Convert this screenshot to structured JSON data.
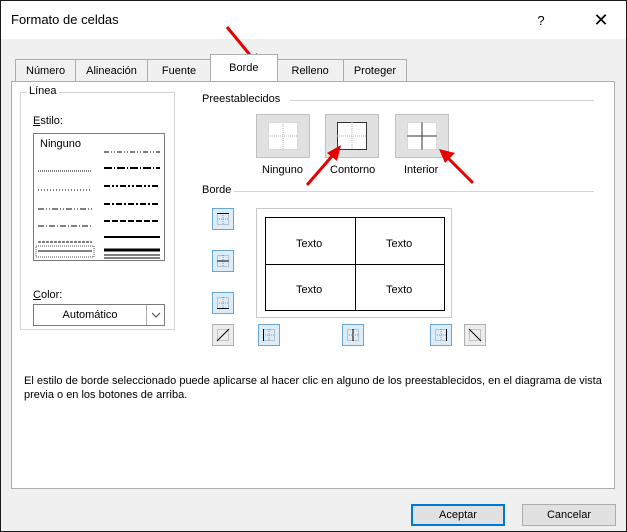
{
  "window": {
    "title": "Formato de celdas",
    "help": "?",
    "close": "✕"
  },
  "tabs": [
    {
      "label": "Número"
    },
    {
      "label": "Alineación"
    },
    {
      "label": "Fuente"
    },
    {
      "label": "Borde"
    },
    {
      "label": "Relleno"
    },
    {
      "label": "Proteger"
    }
  ],
  "active_tab": "Borde",
  "linea": {
    "group": "Línea",
    "estilo": "Estilo:",
    "none_style": "Ninguno",
    "color_label": "Color:",
    "color_value": "Automático"
  },
  "preestablecidos": {
    "label": "Preestablecidos",
    "ninguno": "Ninguno",
    "contorno": "Contorno",
    "interior": "Interior"
  },
  "borde": {
    "label": "Borde"
  },
  "preview": {
    "cells": [
      "Texto",
      "Texto",
      "Texto",
      "Texto"
    ]
  },
  "description": "El estilo de borde seleccionado puede aplicarse al hacer clic en alguno de los preestablecidos, en el diagrama de vista previa o en los botones de arriba.",
  "footer": {
    "ok": "Aceptar",
    "cancel": "Cancelar"
  },
  "colors": {
    "accent": "#0078d7",
    "arrow": "#e60000",
    "toggle_bg": "#dcecf8"
  }
}
